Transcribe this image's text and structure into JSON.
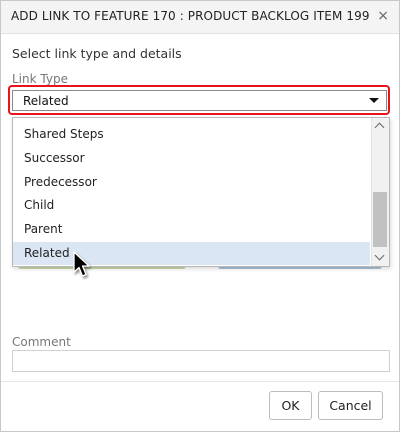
{
  "dialog": {
    "title": "ADD LINK TO FEATURE 170 : PRODUCT BACKLOG ITEM 199",
    "close_icon": "×",
    "subtitle": "Select link type and details"
  },
  "link_type": {
    "label": "Link Type",
    "selected": "Related",
    "options": [
      "Shared Steps",
      "Successor",
      "Predecessor",
      "Child",
      "Parent",
      "Related"
    ],
    "highlighted_option": "Related"
  },
  "comment": {
    "label": "Comment",
    "value": ""
  },
  "buttons": {
    "ok": "OK",
    "cancel": "Cancel"
  },
  "colors": {
    "highlight_border": "#e8141b",
    "selected_option_bg": "#dbe6f4"
  },
  "icons": {
    "close": "close-icon",
    "select_caret": "caret-down-icon",
    "scroll_up": "chevron-up-icon",
    "scroll_down": "chevron-down-icon",
    "pointer": "mouse-cursor-icon"
  }
}
